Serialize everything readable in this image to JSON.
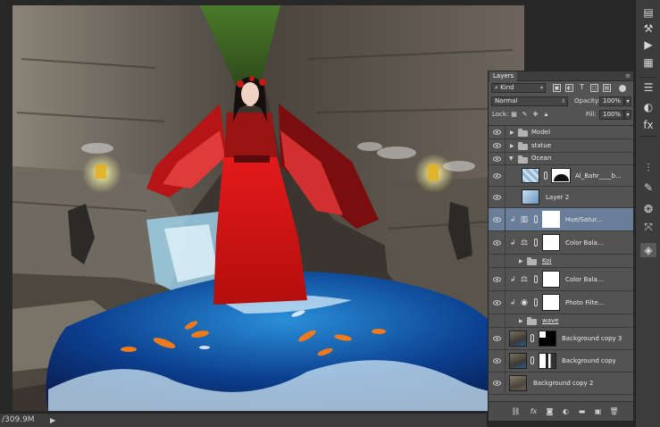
{
  "status_bar": {
    "doc_info": "/309.9M"
  },
  "layers_panel": {
    "tab_label": "Layers",
    "filter_kind": "Kind",
    "blend_mode": "Normal",
    "opacity_label": "Opacity:",
    "opacity_value": "100%",
    "lock_label": "Lock:",
    "fill_label": "Fill:",
    "fill_value": "100%",
    "layers": [
      {
        "name": "Model"
      },
      {
        "name": "statue"
      },
      {
        "name": "Ocean"
      },
      {
        "name": "Al_Bahr____b..."
      },
      {
        "name": "Layer 2"
      },
      {
        "name": "Hue/Satur..."
      },
      {
        "name": "Color Bala..."
      },
      {
        "name": "Koi"
      },
      {
        "name": "Color Bala..."
      },
      {
        "name": "Photo Filte..."
      },
      {
        "name": "wave"
      },
      {
        "name": "Background copy 3"
      },
      {
        "name": "Background copy"
      },
      {
        "name": "Background copy 2"
      }
    ]
  },
  "tool_icons": [
    "history-icon",
    "tool-presets-icon",
    "actions-icon",
    "properties-icon",
    "swatches-icon",
    "adjustments-icon",
    "paths-icon",
    "brush-presets-icon",
    "channels-icon",
    "layers-icon"
  ],
  "colors": {
    "accent_selected": "#6a7d99",
    "panel_bg": "#535353",
    "app_bg": "#282828"
  }
}
